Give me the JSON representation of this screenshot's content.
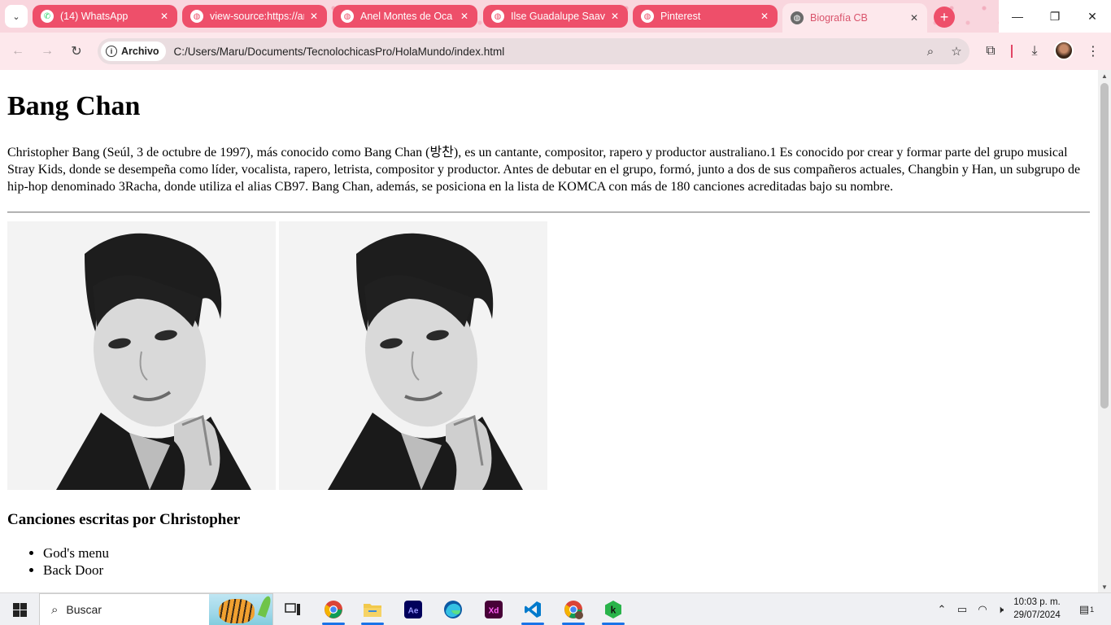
{
  "browser": {
    "tabs": [
      {
        "title": "(14) WhatsApp",
        "icon": "whatsapp-icon",
        "active": false
      },
      {
        "title": "view-source:https://ar",
        "icon": "globe-icon",
        "active": false
      },
      {
        "title": "Anel Montes de Oca",
        "icon": "globe-icon",
        "active": false
      },
      {
        "title": "Ilse Guadalupe Saave",
        "icon": "globe-icon",
        "active": false
      },
      {
        "title": "Pinterest",
        "icon": "globe-icon",
        "active": false
      },
      {
        "title": "Biografía CB",
        "icon": "globe-icon",
        "active": true
      }
    ],
    "address": {
      "chip_label": "Archivo",
      "url": "C:/Users/Maru/Documents/TecnolochicasPro/HolaMundo/index.html"
    },
    "colors": {
      "tab_accent": "#ee4f6a",
      "tabstrip": "#f9d6de",
      "toolbar": "#fde8ec"
    }
  },
  "page": {
    "heading": "Bang Chan",
    "bio": "Christopher Bang (Seúl, 3 de octubre de 1997), más conocido como Bang Chan (방찬), es un cantante, compositor, rapero y productor australiano.1 Es conocido por crear y formar parte del grupo musical Stray Kids, donde se desempeña como líder, vocalista, rapero, letrista, compositor y productor. Antes de debutar en el grupo, formó, junto a dos de sus compañeros actuales, Changbin y Han, un subgrupo de hip-hop denominado 3Racha, donde utiliza el alias CB97. Bang Chan, además, se posiciona en la lista de KOMCA con más de 180 canciones acreditadas bajo su nombre.",
    "songs_heading": "Canciones escritas por Christopher",
    "songs": [
      "God's menu",
      "Back Door"
    ]
  },
  "taskbar": {
    "search_placeholder": "Buscar",
    "time": "10:03 p. m.",
    "date": "29/07/2024",
    "notification_count": "1"
  }
}
